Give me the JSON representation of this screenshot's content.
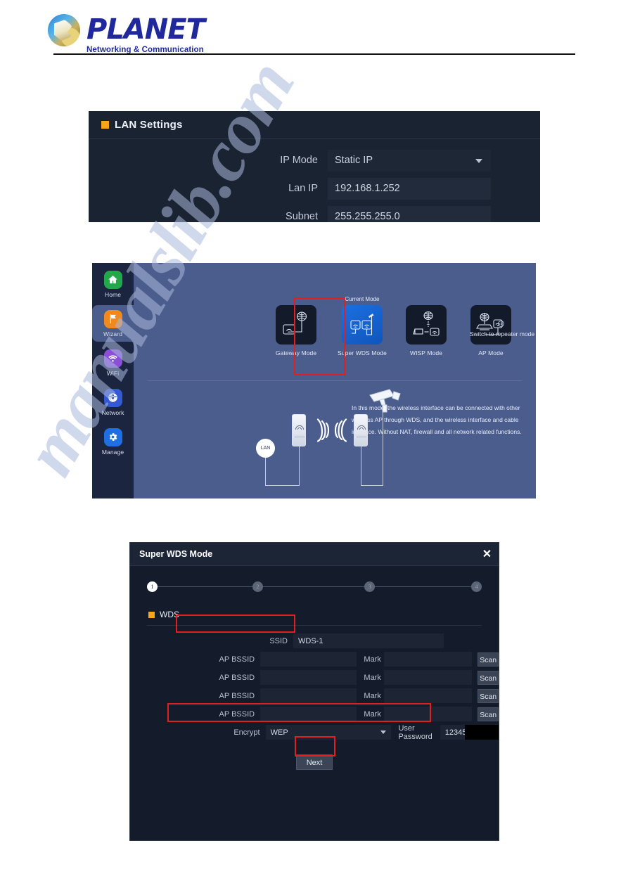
{
  "header": {
    "brand": "PLANET",
    "tagline": "Networking & Communication"
  },
  "watermark": "manualslib.com",
  "lan_settings": {
    "panel_title": "LAN Settings",
    "rows": [
      {
        "label": "IP Mode",
        "value": "Static IP",
        "type": "select"
      },
      {
        "label": "Lan IP",
        "value": "192.168.1.252",
        "type": "text"
      },
      {
        "label": "Subnet",
        "value": "255.255.255.0",
        "type": "text"
      }
    ]
  },
  "wizard": {
    "sidebar": [
      {
        "label": "Home",
        "icon": "home-icon",
        "color": "#22a84a",
        "active": false
      },
      {
        "label": "Wizard",
        "icon": "flag-icon",
        "color": "#f08a1e",
        "active": true
      },
      {
        "label": "WiFi",
        "icon": "wifi-icon",
        "color": "#8a4fd6",
        "active": false
      },
      {
        "label": "Network",
        "icon": "globe-icon",
        "color": "#3558d4",
        "active": false
      },
      {
        "label": "Manage",
        "icon": "gear-icon",
        "color": "#1f6fe0",
        "active": false
      }
    ],
    "current_mode_tag": "Current Mode",
    "modes": [
      {
        "label": "Gateway Mode",
        "icon": "gateway-mode-icon",
        "selected": false
      },
      {
        "label": "Super WDS Mode",
        "icon": "super-wds-mode-icon",
        "selected": true
      },
      {
        "label": "WISP Mode",
        "icon": "wisp-mode-icon",
        "selected": false
      },
      {
        "label": "AP Mode",
        "icon": "ap-mode-icon",
        "selected": false
      }
    ],
    "repeater_note": "Switch to repeater mode",
    "info_icon_glyph": "i",
    "description": "In this mode, the wireless interface can be connected with other wireless AP through WDS, and the wireless interface and cable interface. Without NAT, firewall and all network related functions.",
    "diagram_lan_label": "LAN"
  },
  "dialog": {
    "title": "Super WDS Mode",
    "close_glyph": "✕",
    "steps": [
      {
        "number": "1",
        "state": "done"
      },
      {
        "number": "2",
        "state": "todo"
      },
      {
        "number": "3",
        "state": "todo"
      },
      {
        "number": "4",
        "state": "todo"
      }
    ],
    "section_title": "WDS",
    "ssid": {
      "label": "SSID",
      "value": "WDS-1"
    },
    "bssid_rows": [
      {
        "label": "AP BSSID",
        "value": "",
        "mark_label": "Mark",
        "mark_value": "",
        "scan_label": "Scan"
      },
      {
        "label": "AP BSSID",
        "value": "",
        "mark_label": "Mark",
        "mark_value": "",
        "scan_label": "Scan"
      },
      {
        "label": "AP BSSID",
        "value": "",
        "mark_label": "Mark",
        "mark_value": "",
        "scan_label": "Scan"
      },
      {
        "label": "AP BSSID",
        "value": "",
        "mark_label": "Mark",
        "mark_value": "",
        "scan_label": "Scan"
      }
    ],
    "encrypt": {
      "label": "Encrypt",
      "value": "WEP"
    },
    "password": {
      "label": "User Password",
      "value": "12345"
    },
    "next_label": "Next"
  },
  "colors": {
    "panel_bg": "#1a2331",
    "dialog_bg": "#141c2b",
    "wizard_bg": "#4b5d8c",
    "accent_orange": "#f7a51b",
    "highlight_red": "#e02020",
    "selected_tile_blue": "#1b6fe0"
  }
}
